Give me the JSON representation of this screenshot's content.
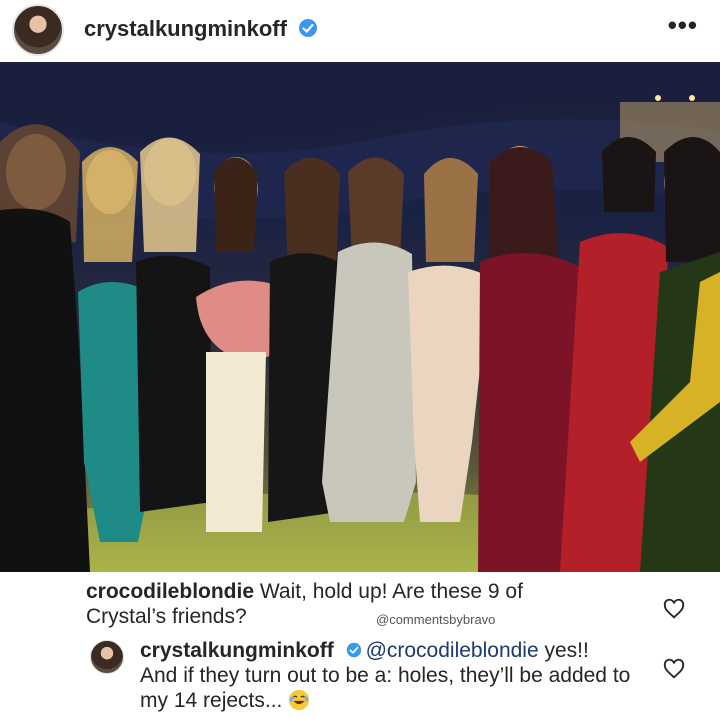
{
  "post": {
    "username": "crystalkungminkoff",
    "more_label": "•••"
  },
  "comments": [
    {
      "username": "crocodileblondie",
      "text": " Wait, hold up! Are these 9 of Crystal’s friends?"
    }
  ],
  "watermark": "@commentsbybravo",
  "reply": {
    "username": "crystalkungminkoff",
    "mention": "@crocodileblondie",
    "text_after_mention": " yes!!",
    "text": "And if they turn out to be a:  holes, they’ll be added to my 14 rejects...",
    "emoji": "laughing-emoji"
  },
  "colors": {
    "verified": "#3897f0",
    "mention": "#1d3a72"
  }
}
